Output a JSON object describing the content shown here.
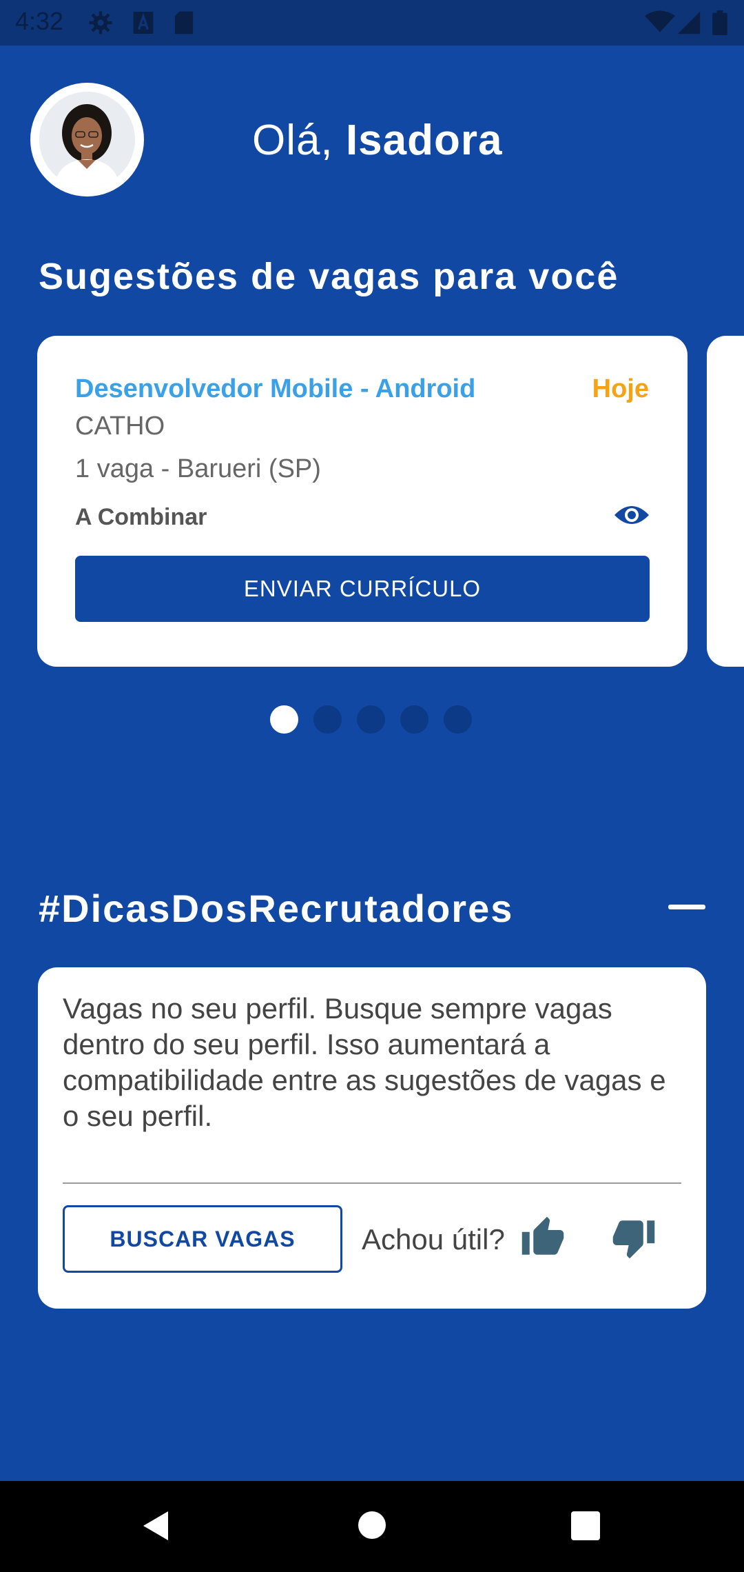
{
  "status_bar": {
    "time": "4:32",
    "left_icons": [
      "gear-icon",
      "text-a-icon",
      "sd-card-icon"
    ],
    "right_icons": [
      "wifi-icon",
      "signal-icon",
      "battery-icon"
    ]
  },
  "header": {
    "greeting_prefix": "Olá,",
    "user_name": "Isadora"
  },
  "suggestions": {
    "title": "Sugestões de vagas para você",
    "card": {
      "job_title": "Desenvolvedor Mobile - Android",
      "date": "Hoje",
      "company": "CATHO",
      "location": "1 vaga - Barueri (SP)",
      "salary": "A Combinar",
      "send_button": "ENVIAR CURRÍCULO"
    },
    "pagination": {
      "total": 5,
      "active": 1
    }
  },
  "tips": {
    "title": "#DicasDosRecrutadores",
    "text": "Vagas no seu perfil. Busque sempre vagas dentro do seu perfil. Isso aumentará a compatibilidade entre as sugestões de vagas e o seu perfil.",
    "search_button": "BUSCAR VAGAS",
    "useful_label": "Achou útil?"
  },
  "colors": {
    "background": "#1148a3",
    "job_title": "#3aa1e8",
    "date_accent": "#f5a215",
    "card": "#ffffff"
  }
}
